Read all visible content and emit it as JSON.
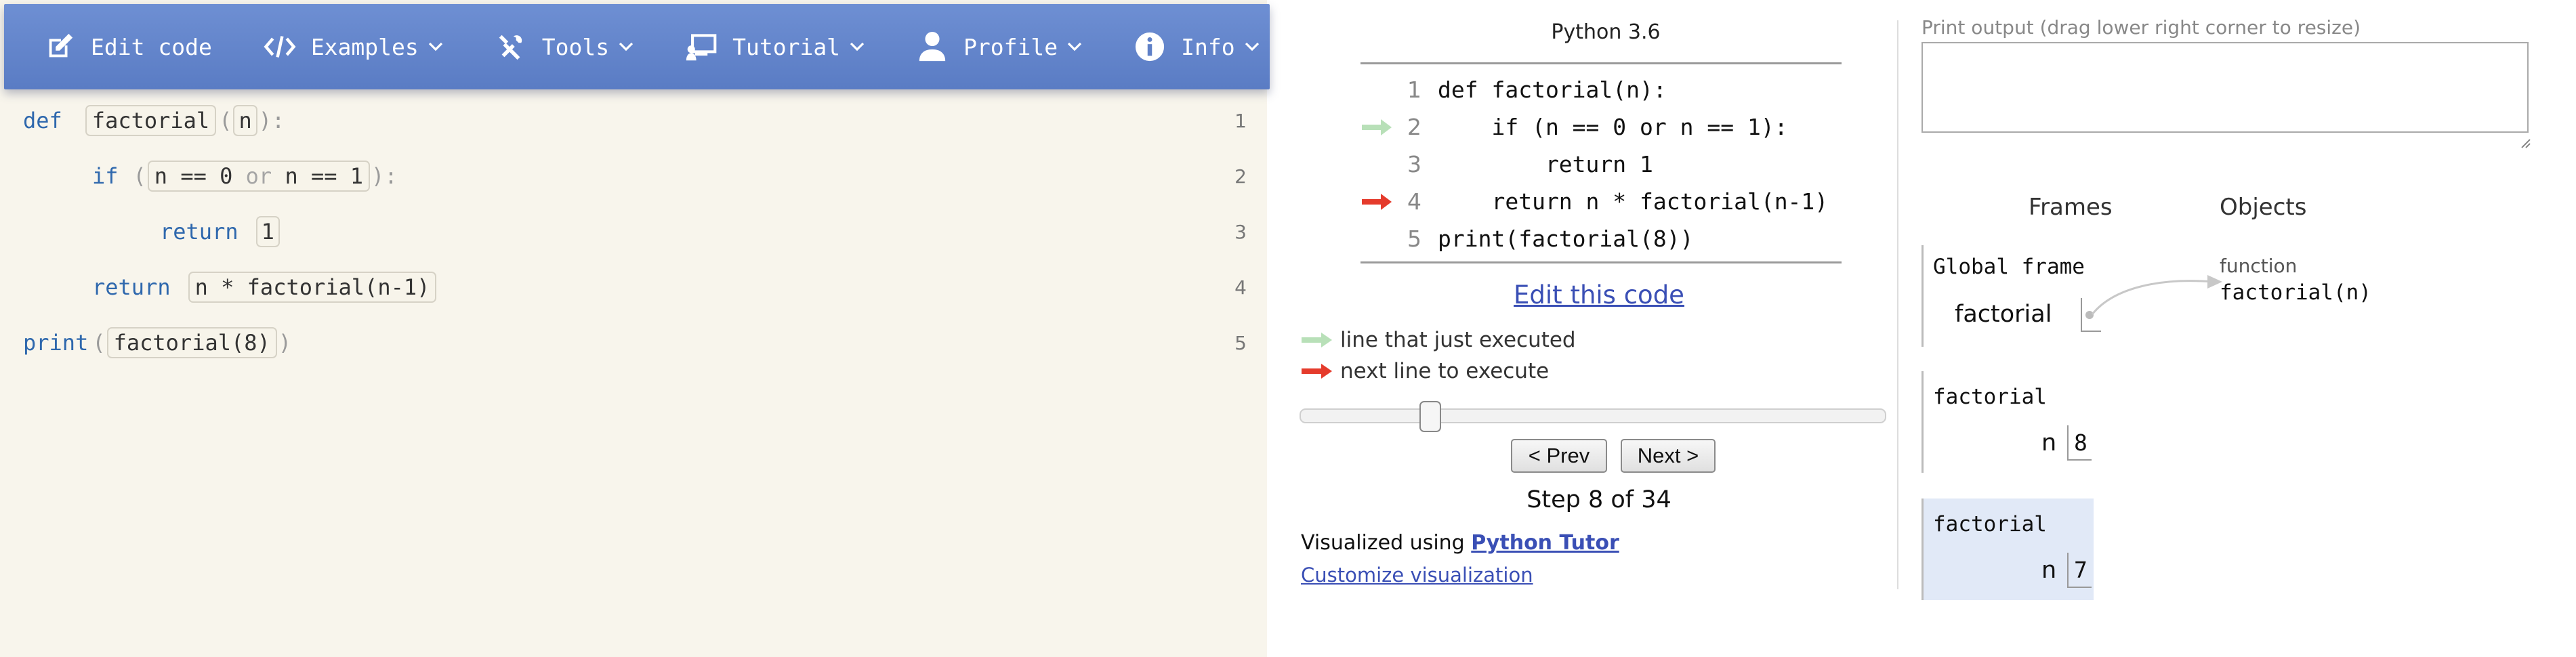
{
  "nav": {
    "items": [
      {
        "label": "Edit code",
        "icon": "pencil-square-icon",
        "has_dropdown": false
      },
      {
        "label": "Examples",
        "icon": "code-brackets-icon",
        "has_dropdown": true
      },
      {
        "label": "Tools",
        "icon": "wrench-screwdriver-icon",
        "has_dropdown": true
      },
      {
        "label": "Tutorial",
        "icon": "presentation-icon",
        "has_dropdown": true
      },
      {
        "label": "Profile",
        "icon": "user-icon",
        "has_dropdown": true
      },
      {
        "label": "Info",
        "icon": "info-circle-icon",
        "has_dropdown": true
      }
    ]
  },
  "editor": {
    "background": "#f8f5ec",
    "lines": [
      {
        "num": "1",
        "kw": "def",
        "name": "factorial",
        "open": "(",
        "arg": "n",
        "close": "):"
      },
      {
        "num": "2",
        "kw": "if",
        "open": "(",
        "cond_a": "n == 0",
        "op": "or",
        "cond_b": "n == 1",
        "close": "):"
      },
      {
        "num": "3",
        "kw": "return",
        "value": "1"
      },
      {
        "num": "4",
        "kw": "return",
        "expr": "n * factorial(n-1)"
      },
      {
        "num": "5",
        "kw": "print",
        "open": "(",
        "arg": "factorial(8)",
        "close": ")"
      }
    ]
  },
  "viz": {
    "title": "Python 3.6",
    "lines": [
      {
        "num": "1",
        "code": "def factorial(n):"
      },
      {
        "num": "2",
        "code": "    if (n == 0 or n == 1):"
      },
      {
        "num": "3",
        "code": "        return 1"
      },
      {
        "num": "4",
        "code": "    return n * factorial(n-1)"
      },
      {
        "num": "5",
        "code": "print(factorial(8))"
      }
    ],
    "just_executed_line": "2",
    "next_line": "4",
    "edit_link": "Edit this code",
    "legend_just_executed": "line that just executed",
    "legend_next": "next line to execute",
    "colors": {
      "just_executed": "#b8e0b8",
      "next": "#e53b2c",
      "link": "#3a4fb5"
    },
    "step_current": 8,
    "step_total": 34,
    "prev_label": "< Prev",
    "next_label": "Next >",
    "step_text": "Step 8 of 34",
    "visualized_using": "Visualized using",
    "tool_link": "Python Tutor",
    "customize": "Customize visualization"
  },
  "right": {
    "print_label": "Print output (drag lower right corner to resize)",
    "frames_header": "Frames",
    "objects_header": "Objects",
    "global_frame": {
      "title": "Global frame",
      "var": "factorial"
    },
    "frames": [
      {
        "title": "factorial",
        "var": "n",
        "value": "8",
        "active": false
      },
      {
        "title": "factorial",
        "var": "n",
        "value": "7",
        "active": true
      }
    ],
    "object": {
      "kind": "function",
      "signature": "factorial(n)"
    },
    "active_frame_color": "#e1e9f7"
  }
}
